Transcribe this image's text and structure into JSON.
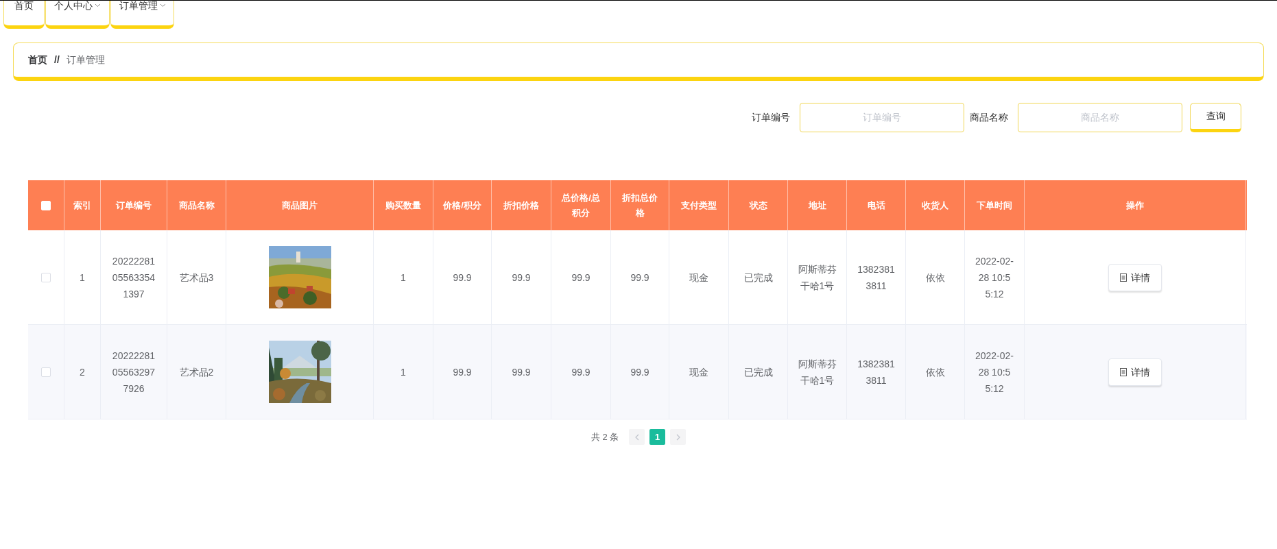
{
  "nav": {
    "tabs": [
      {
        "label": "首页",
        "has_menu": false
      },
      {
        "label": "个人中心",
        "has_menu": true
      },
      {
        "label": "订单管理",
        "has_menu": true
      }
    ]
  },
  "breadcrumb": {
    "home": "首页",
    "separator": "//",
    "current": "订单管理"
  },
  "search": {
    "fields": [
      {
        "label": "订单编号",
        "placeholder": "订单编号"
      },
      {
        "label": "商品名称",
        "placeholder": "商品名称"
      }
    ],
    "button": "查询"
  },
  "table": {
    "select_all_checked": false,
    "columns": [
      "索引",
      "订单编号",
      "商品名称",
      "商品图片",
      "购买数量",
      "价格/积分",
      "折扣价格",
      "总价格/总积分",
      "折扣总价格",
      "支付类型",
      "状态",
      "地址",
      "电话",
      "收货人",
      "下单时间",
      "操作"
    ],
    "rows": [
      {
        "checked": false,
        "index": "1",
        "order_no": "20222281055633541397",
        "product": "艺术品3",
        "quantity": "1",
        "price": "99.9",
        "discount_price": "99.9",
        "total": "99.9",
        "discount_total": "99.9",
        "payment": "现金",
        "status": "已完成",
        "address": "阿斯蒂芬干哈1号",
        "phone": "13823813811",
        "receiver": "依依",
        "time": "2022-02-28 10:55:12",
        "action": "详情"
      },
      {
        "checked": false,
        "index": "2",
        "order_no": "20222281055632977926",
        "product": "艺术品2",
        "quantity": "1",
        "price": "99.9",
        "discount_price": "99.9",
        "total": "99.9",
        "discount_total": "99.9",
        "payment": "现金",
        "status": "已完成",
        "address": "阿斯蒂芬干哈1号",
        "phone": "13823813811",
        "receiver": "依依",
        "time": "2022-02-28 10:55:12",
        "action": "详情"
      }
    ]
  },
  "pagination": {
    "total": "共 2 条",
    "prev_disabled": true,
    "next_disabled": true,
    "pages": [
      {
        "label": "1",
        "selected": true
      }
    ]
  }
}
